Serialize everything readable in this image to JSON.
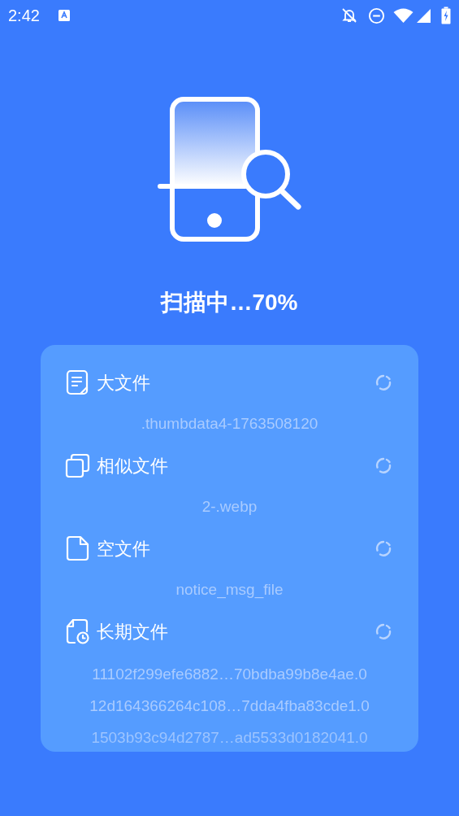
{
  "status_bar": {
    "time": "2:42"
  },
  "scan": {
    "title": "扫描中…70%"
  },
  "categories": [
    {
      "kind": "large",
      "label": "大文件",
      "files": [
        ".thumbdata4-1763508120"
      ]
    },
    {
      "kind": "similar",
      "label": "相似文件",
      "files": [
        "2-.webp"
      ]
    },
    {
      "kind": "empty",
      "label": "空文件",
      "files": [
        "notice_msg_file"
      ]
    },
    {
      "kind": "old",
      "label": "长期文件",
      "files": [
        "11102f299efe6882…70bdba99b8e4ae.0",
        "12d164366264c108…7dda4fba83cde1.0",
        "1503b93c94d2787…ad5533d0182041.0"
      ]
    }
  ]
}
